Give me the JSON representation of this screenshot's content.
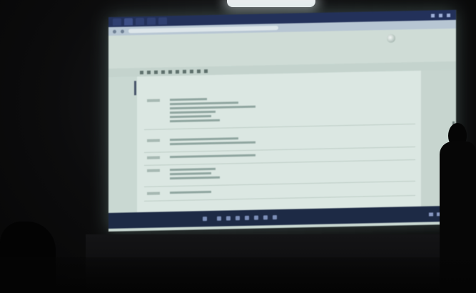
{
  "browser": {
    "tabs": [
      {
        "label": "",
        "active": false
      },
      {
        "label": "",
        "active": true
      },
      {
        "label": "",
        "active": false
      },
      {
        "label": "",
        "active": false
      },
      {
        "label": "",
        "active": false
      }
    ]
  },
  "notebook": {
    "title": "",
    "status": "",
    "logout": "",
    "menu": [
      "",
      "",
      "",
      "",
      "",
      "",
      "",
      ""
    ],
    "trusted": "",
    "kernel": "",
    "celltype": "",
    "heading": "",
    "cells": []
  },
  "taskbar": {
    "search": "",
    "time": ""
  },
  "colors": {
    "screen_glow": "#c9d8d2",
    "taskbar": "#1d2a45",
    "browser_tabs": "#23315a"
  }
}
